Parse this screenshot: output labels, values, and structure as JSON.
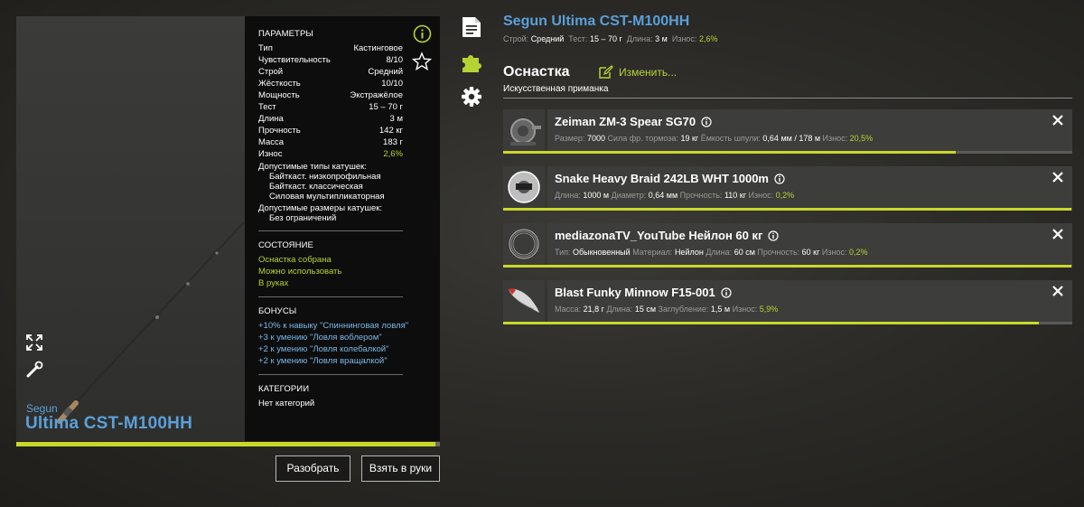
{
  "rod": {
    "brand": "Segun",
    "model": "Ultima CST-M100HH",
    "full_name": "Segun Ultima CST-M100HH",
    "wear_fraction": 0.99
  },
  "params": {
    "title": "ПАРАМЕТРЫ",
    "rows": [
      {
        "label": "Тип",
        "value": "Кастинговое"
      },
      {
        "label": "Чувствительность",
        "value": "8/10"
      },
      {
        "label": "Строй",
        "value": "Средний"
      },
      {
        "label": "Жёсткость",
        "value": "10/10"
      },
      {
        "label": "Мощность",
        "value": "Экстражёлое"
      },
      {
        "label": "Тест",
        "value": "15 – 70 г"
      },
      {
        "label": "Длина",
        "value": "3 м"
      },
      {
        "label": "Прочность",
        "value": "142 кг"
      },
      {
        "label": "Масса",
        "value": "183 г"
      },
      {
        "label": "Износ",
        "value": "2,6%"
      }
    ],
    "reel_types_label": "Допустимые типы катушек:",
    "reel_types": [
      "Байткаст. низкопрофильная",
      "Байткаст. классическая",
      "Силовая мультипликаторная"
    ],
    "reel_sizes_label": "Допустимые размеры катушек:",
    "reel_sizes": [
      "Без ограничений"
    ]
  },
  "state": {
    "title": "СОСТОЯНИЕ",
    "lines": [
      "Оснастка собрана",
      "Можно использовать",
      "В руках"
    ]
  },
  "bonuses": {
    "title": "БОНУСЫ",
    "lines": [
      "+10% к навыку \"Спиннинговая ловля\"",
      "+3 к умению \"Ловля воблером\"",
      "+2 к умению \"Ловля колебалкой\"",
      "+2 к умению \"Ловля вращалкой\""
    ]
  },
  "categories": {
    "title": "КАТЕГОРИИ",
    "value": "Нет категорий"
  },
  "buttons": {
    "disassemble": "Разобрать",
    "take": "Взять в руки"
  },
  "header_stats": {
    "action_label": "Строй:",
    "action_value": "Средний",
    "test_label": "Тест:",
    "test_value": "15 – 70 г",
    "length_label": "Длина:",
    "length_value": "3 м",
    "wear_label": "Износ:",
    "wear_value": "2,6%"
  },
  "tackle": {
    "title": "Оснастка",
    "edit_label": "Изменить...",
    "lure_type": "Искусственная приманка",
    "items": [
      {
        "name": "Zeiman ZM-3 Spear SG70",
        "stats": [
          {
            "label": "Размер:",
            "value": "7000"
          },
          {
            "label": "Сила фр. тормоза:",
            "value": "19 кг"
          },
          {
            "label": "Ёмкость шпули:",
            "value": "0,64 мм / 178 м"
          },
          {
            "label": "Износ:",
            "value": "20,5%",
            "accent": true
          }
        ],
        "wear_fraction": 0.795
      },
      {
        "name": "Snake Heavy Braid 242LB WHT 1000m",
        "stats": [
          {
            "label": "Длина:",
            "value": "1000 м"
          },
          {
            "label": "Диаметр:",
            "value": "0,64 мм"
          },
          {
            "label": "Прочность:",
            "value": "110 кг"
          },
          {
            "label": "Износ:",
            "value": "0,2%",
            "accent": true
          }
        ],
        "wear_fraction": 0.998
      },
      {
        "name": "mediazonaTV_YouTube Нейлон 60 кг",
        "stats": [
          {
            "label": "Тип:",
            "value": "Обыкновенный"
          },
          {
            "label": "Материал:",
            "value": "Нейлон"
          },
          {
            "label": "Длина:",
            "value": "60 см"
          },
          {
            "label": "Прочность:",
            "value": "60 кг"
          },
          {
            "label": "Износ:",
            "value": "0,2%",
            "accent": true
          }
        ],
        "wear_fraction": 0.998
      },
      {
        "name": "Blast Funky Minnow F15-001",
        "stats": [
          {
            "label": "Масса:",
            "value": "21,8 г"
          },
          {
            "label": "Длина:",
            "value": "15 см"
          },
          {
            "label": "Заглубление:",
            "value": "1,5 м"
          },
          {
            "label": "Износ:",
            "value": "5,9%",
            "accent": true
          }
        ],
        "wear_fraction": 0.941
      }
    ]
  },
  "colors": {
    "accent_blue": "#5aa0d8",
    "accent_green": "#b5d434",
    "wear_bar": "#c8d82a"
  },
  "icons": [
    "info-icon",
    "star-icon",
    "expand-icon",
    "tools-icon",
    "document-icon",
    "puzzle-icon",
    "gear-icon",
    "edit-icon",
    "close-icon"
  ]
}
